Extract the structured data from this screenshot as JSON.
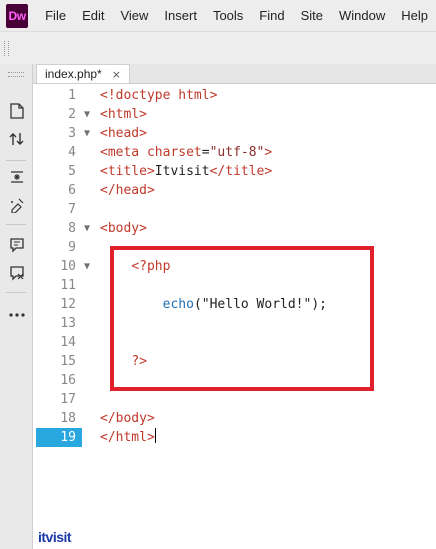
{
  "app": {
    "logo_text": "Dw"
  },
  "menu": [
    "File",
    "Edit",
    "View",
    "Insert",
    "Tools",
    "Find",
    "Site",
    "Window",
    "Help"
  ],
  "tab": {
    "label": "index.php*",
    "close": "×"
  },
  "editor": {
    "lines": [
      {
        "n": "1",
        "fold": "",
        "code": "<!doctype html>"
      },
      {
        "n": "2",
        "fold": "▼",
        "code": "<html>"
      },
      {
        "n": "3",
        "fold": "▼",
        "code": "<head>"
      },
      {
        "n": "4",
        "fold": "",
        "code": "<meta charset=\"utf-8\">"
      },
      {
        "n": "5",
        "fold": "",
        "code": "<title>Itvisit</title>"
      },
      {
        "n": "6",
        "fold": "",
        "code": "</head>"
      },
      {
        "n": "7",
        "fold": "",
        "code": ""
      },
      {
        "n": "8",
        "fold": "▼",
        "code": "<body>"
      },
      {
        "n": "9",
        "fold": "",
        "code": ""
      },
      {
        "n": "10",
        "fold": "▼",
        "code": "    <?php"
      },
      {
        "n": "11",
        "fold": "",
        "code": ""
      },
      {
        "n": "12",
        "fold": "",
        "code": "        echo(\"Hello World!\");"
      },
      {
        "n": "13",
        "fold": "",
        "code": ""
      },
      {
        "n": "14",
        "fold": "",
        "code": ""
      },
      {
        "n": "15",
        "fold": "",
        "code": "    ?>"
      },
      {
        "n": "16",
        "fold": "",
        "code": ""
      },
      {
        "n": "17",
        "fold": "",
        "code": ""
      },
      {
        "n": "18",
        "fold": "",
        "code": "</body>"
      },
      {
        "n": "19",
        "fold": "",
        "code": "</html>"
      }
    ],
    "active_line": "19"
  },
  "watermark": "itvisit",
  "colors": {
    "accent": "#29a8e0",
    "highlight": "#e0202a",
    "logo_bg": "#470137",
    "logo_fg": "#ff61f6"
  }
}
